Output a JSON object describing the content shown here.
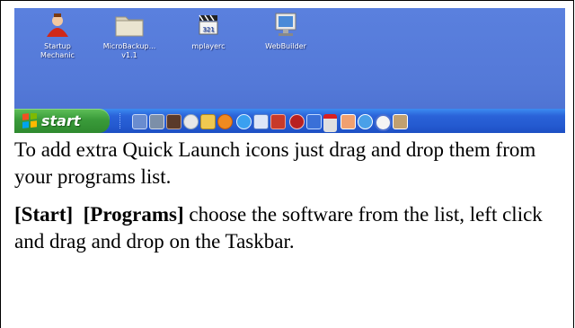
{
  "desktop": {
    "icons": [
      {
        "label": "Startup\nMechanic",
        "icon": "startup-mechanic-icon"
      },
      {
        "label": "MicroBackup...\nv1.1",
        "icon": "folder-icon"
      },
      {
        "label": "mplayerc",
        "icon": "media-player-icon"
      },
      {
        "label": "WebBuilder",
        "icon": "monitor-icon"
      }
    ]
  },
  "taskbar": {
    "start_label": "start",
    "quick_launch_icons": [
      "show-desktop-icon",
      "network-icon",
      "film-icon",
      "clock-icon",
      "folder-icon",
      "firefox-icon",
      "ie-icon",
      "window-icon",
      "media-icon",
      "red-app-icon",
      "blue-app-icon",
      "red-white-icon",
      "photo-icon",
      "globe-icon",
      "cd-icon",
      "gear-icon"
    ]
  },
  "doc": {
    "para1": "To add extra Quick Launch icons just drag and drop them from your programs list.",
    "para2_bold1": "[Start]",
    "para2_bold2": "[Programs]",
    "para2_rest": " choose the software from the list, left click and drag and drop on the Taskbar."
  },
  "colors": {
    "desktop": "#5a7edc",
    "taskbar": "#245ad0",
    "start_button": "#3a9b3a"
  }
}
